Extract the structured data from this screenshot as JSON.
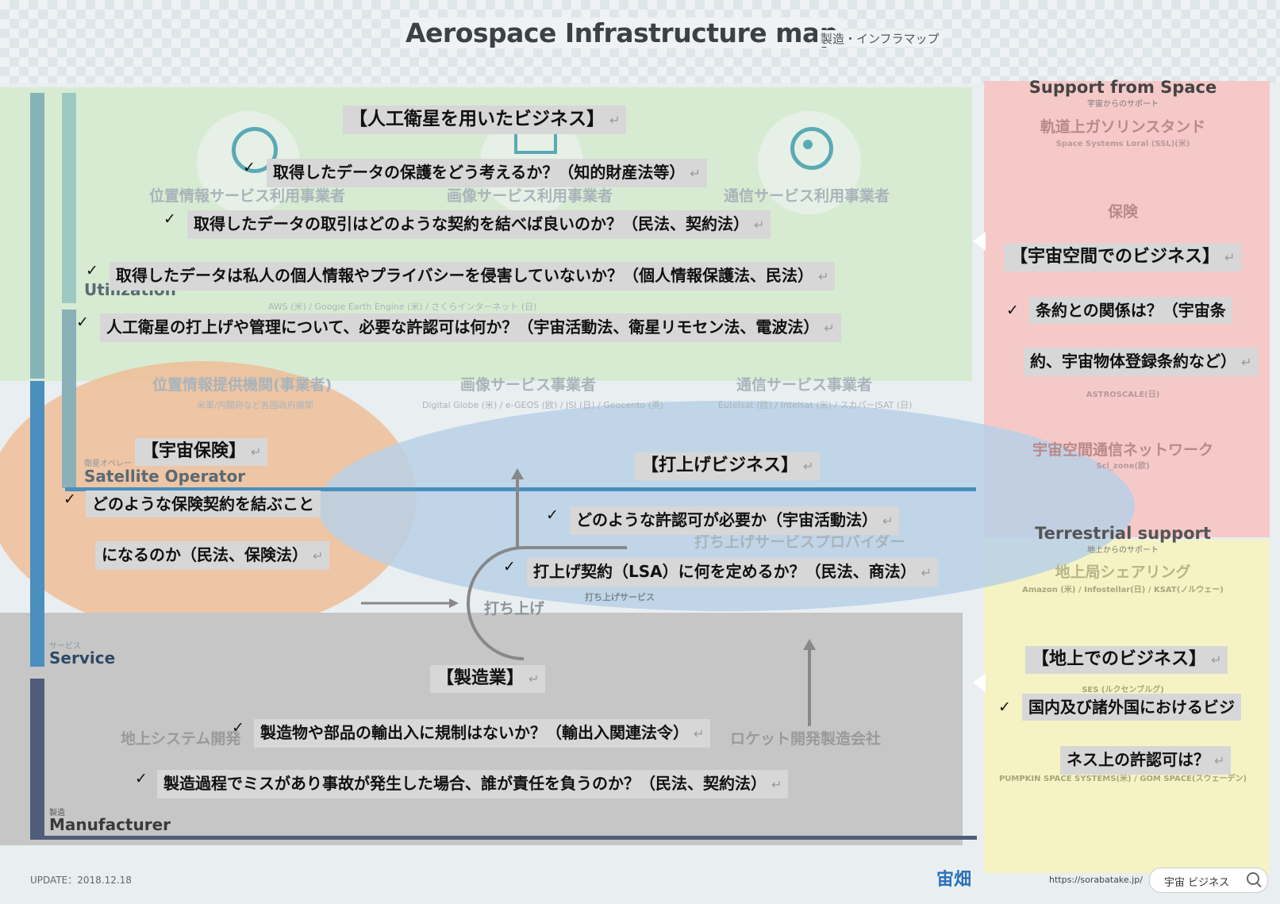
{
  "header": {
    "title": "Aerospace Infrastructure map",
    "subtitle": "製造・インフラマップ"
  },
  "background": {
    "utilization_label": "Utilization",
    "satellite_operator_jp": "衛星オペレー",
    "satellite_operator_label": "Satellite Operator",
    "service_jp": "サービス",
    "service_label": "Service",
    "manufacturer_jp": "製造",
    "manufacturer_label": "Manufacturer",
    "cols_top": [
      "位置情報サービス利用事業者",
      "画像サービス利用事業者",
      "通信サービス利用事業者"
    ],
    "cols_mid": [
      "位置情報提供機関(事業者)",
      "画像サービス事業者",
      "通信サービス事業者"
    ],
    "mid_companies": [
      "米軍/内閣府など各国政府機関",
      "Digital Globe (米) / e-GEOS (欧) / JSI (日) / Geocento (英)",
      "Eutelsat (欧) / Intelsat (米) / スカパーJSAT (日)"
    ],
    "launch_provider": "打ち上げサービスプロバイダー",
    "launch_label": "打ち上げ",
    "launch_service": "打ち上げサービス",
    "ground_dev": "地上システム開発",
    "rocket_dev": "ロケット開発製造会社",
    "aws_line": "AWS (米) / Google Earth Engine (米) / さくらインターネット (日)"
  },
  "zones": {
    "satellite_business": {
      "title": "【人工衛星を用いたビジネス】",
      "items": [
        "取得したデータの保護をどう考えるか？（知的財産法等）",
        "取得したデータの取引はどのような契約を結べば良いのか？（民法、契約法）",
        "取得したデータは私人の個人情報やプライバシーを侵害していないか？（個人情報保護法、民法）",
        "人工衛星の打上げや管理について、必要な許認可は何か？（宇宙活動法、衛星リモセン法、電波法）"
      ]
    },
    "insurance": {
      "title": "【宇宙保険】",
      "items": [
        "どのような保険契約を結ぶこと",
        "になるのか（民法、保険法）"
      ]
    },
    "launch": {
      "title": "【打上げビジネス】",
      "items": [
        "どのような許認可が必要か（宇宙活動法）",
        "打上げ契約（LSA）に何を定めるか？（民法、商法）"
      ]
    },
    "manufacturing": {
      "title": "【製造業】",
      "items": [
        "製造物や部品の輸出入に規制はないか？（輸出入関連法令）",
        "製造過程でミスがあり事故が発生した場合、誰が責任を負うのか？（民法、契約法）"
      ]
    },
    "space_business": {
      "title": "【宇宙空間でのビジネス】",
      "items": [
        "条約との関係は？（宇宙条",
        "約、宇宙物体登録条約など）"
      ]
    },
    "ground_business": {
      "title": "【地上でのビジネス】",
      "items": [
        "国内及び諸外国におけるビジ",
        "ネス上の許認可は？"
      ]
    }
  },
  "right_panel": {
    "support_space": "Support from Space",
    "support_space_jp": "宇宙からのサポート",
    "gas_station": "軌道上ガソリンスタンド",
    "gas_company": "Space Systems Loral (SSL)(米)",
    "insurance_head": "保険",
    "debris_company": "ASTROSCALE(日)",
    "network_head": "宇宙空間通信ネットワーク",
    "network_company": "Sci_zone(欧)",
    "terrestrial": "Terrestrial support",
    "terrestrial_jp": "地上からのサポート",
    "ground_share": "地上局シェアリング",
    "ground_share_company": "Amazon (米) / Infostellar(日) / KSAT(ノルウェー)",
    "ses": "SES (ルクセンブルグ)",
    "pumpkin": "PUMPKIN SPACE SYSTEMS(米) / GOM SPACE(スウェーデン)"
  },
  "footer": {
    "update": "UPDATE：2018.12.18",
    "brand": "宙畑",
    "url": "https://sorabatake.jp/",
    "search": "宇宙 ビジネス"
  },
  "colors": {
    "green": "#d6ead0",
    "pink": "#f6c9c9",
    "yellow": "#f5f3c4",
    "gray": "#c6c6c6",
    "orange": "#eebd98",
    "blue": "#b9d0e6"
  }
}
